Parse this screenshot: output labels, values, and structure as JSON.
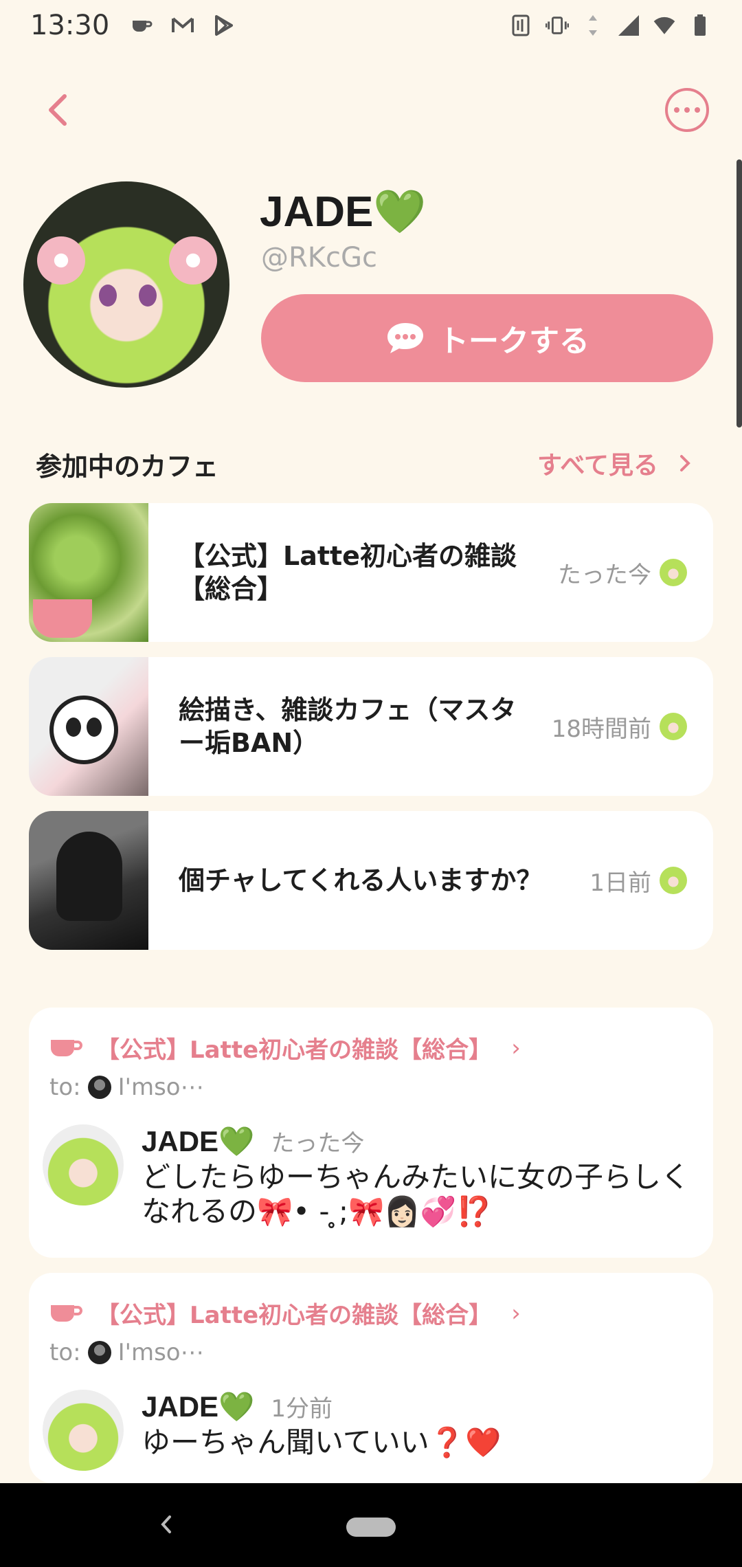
{
  "status_bar": {
    "time": "13:30",
    "left_icons": [
      "coffee-notification-icon",
      "gmail-icon",
      "play-store-icon"
    ],
    "right_icons": [
      "nfc-icon",
      "vibrate-icon",
      "data-arrows-icon",
      "signal-icon",
      "wifi-icon",
      "battery-icon"
    ]
  },
  "top_bar": {
    "back_icon": "chevron-left-icon",
    "more_icon": "more-horizontal-icon"
  },
  "profile": {
    "name": "JADE💚",
    "handle": "@RKcGc",
    "talk_button_label": "トークする"
  },
  "cafes_section": {
    "title": "参加中のカフェ",
    "see_all_label": "すべて見る",
    "items": [
      {
        "name": "【公式】Latte初心者の雑談【総合】",
        "time": "たった今"
      },
      {
        "name": "絵描き、雑談カフェ（マスター垢BAN）",
        "time": "18時間前"
      },
      {
        "name": "個チャしてくれる人いますか？",
        "time": "1日前"
      }
    ]
  },
  "posts": [
    {
      "cafe": "【公式】Latte初心者の雑談【総合】",
      "to_prefix": "to:",
      "to_name": "I'mso⋯",
      "author": "JADE💚",
      "time": "たった今",
      "body": "どしたらゆーちゃんみたいに女の子らしくなれるの🎀• - ̥;🎀👩🏻💞⁉️"
    },
    {
      "cafe": "【公式】Latte初心者の雑談【総合】",
      "to_prefix": "to:",
      "to_name": "I'mso⋯",
      "author": "JADE💚",
      "time": "1分前",
      "body": "ゆーちゃん聞いていい❓❤️"
    }
  ],
  "colors": {
    "background": "#fdf7ec",
    "accent": "#e57f8d",
    "button": "#ef8d98"
  }
}
